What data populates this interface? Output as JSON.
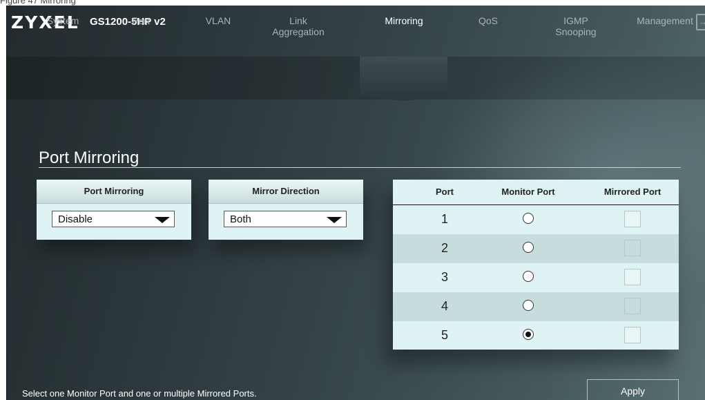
{
  "caption": "Figure 47 Mirroring",
  "header": {
    "brand": "ZYXEL",
    "model": "GS1200-5HP v2",
    "logout_icon": "logout-icon"
  },
  "nav": {
    "tabs": [
      {
        "label": "System"
      },
      {
        "label": "Port"
      },
      {
        "label": "VLAN"
      },
      {
        "label": "Link Aggregation"
      },
      {
        "label": "Mirroring",
        "active": true
      },
      {
        "label": "QoS"
      },
      {
        "label": "IGMP Snooping"
      },
      {
        "label": "Management"
      }
    ]
  },
  "main": {
    "title": "Port Mirroring",
    "port_mirroring": {
      "header": "Port Mirroring",
      "value": "Disable",
      "options": [
        "Disable"
      ]
    },
    "mirror_direction": {
      "header": "Mirror Direction",
      "value": "Both",
      "options": [
        "Both"
      ]
    },
    "table": {
      "headers": {
        "port": "Port",
        "monitor": "Monitor Port",
        "mirrored": "Mirrored Port"
      },
      "rows": [
        {
          "port": "1",
          "monitor": false,
          "mirrored": false
        },
        {
          "port": "2",
          "monitor": false,
          "mirrored": false
        },
        {
          "port": "3",
          "monitor": false,
          "mirrored": false
        },
        {
          "port": "4",
          "monitor": false,
          "mirrored": false
        },
        {
          "port": "5",
          "monitor": true,
          "mirrored": false
        }
      ]
    },
    "hint": "Select one Monitor Port and one or multiple Mirrored Ports.",
    "apply_label": "Apply"
  }
}
